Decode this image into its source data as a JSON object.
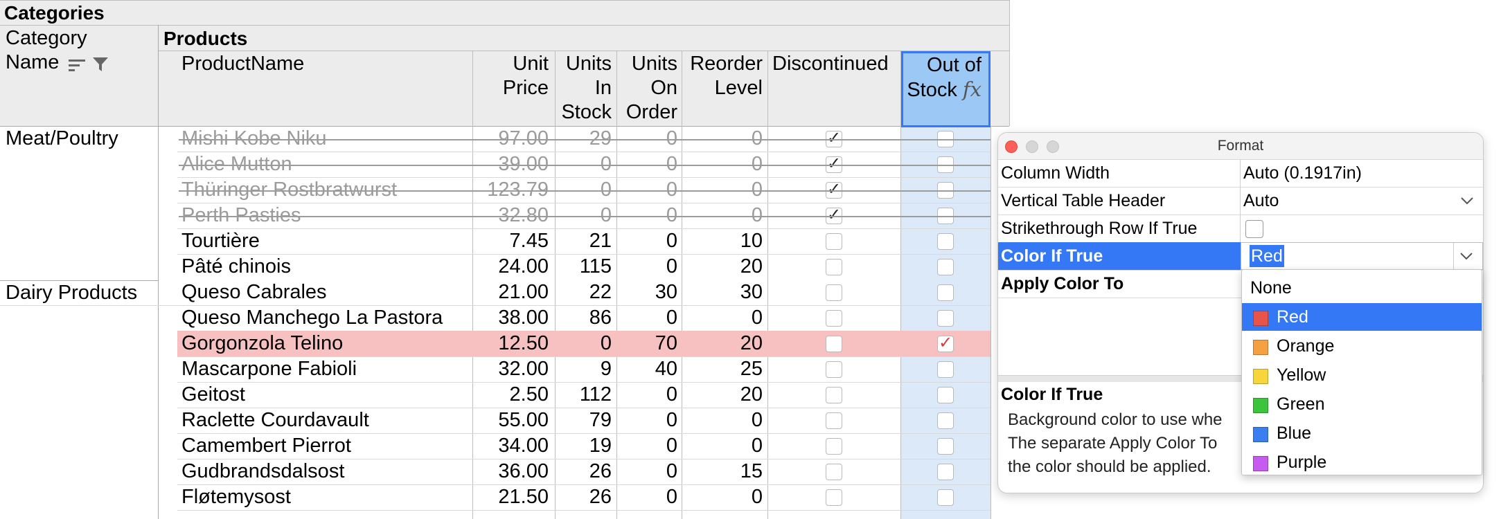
{
  "table": {
    "group_header": "Categories",
    "category_header_line1": "Category",
    "category_header_line2": "Name",
    "products_header": "Products",
    "columns": {
      "name": "ProductName",
      "price": [
        "Unit",
        "Price"
      ],
      "stock": [
        "Units",
        "In",
        "Stock"
      ],
      "order": [
        "Units",
        "On",
        "Order"
      ],
      "reorder": [
        "Reorder",
        "Level"
      ],
      "discontinued": "Discontinued",
      "outofstock": [
        "Out of",
        "Stock"
      ],
      "formula_symbol": "fx"
    },
    "categories": [
      "Meat/Poultry",
      "Dairy Products"
    ],
    "rows": [
      {
        "name": "Mishi Kobe Niku",
        "price": "97.00",
        "stock": "29",
        "order": "0",
        "reorder": "0",
        "disc": true,
        "oos": false,
        "style": "strike"
      },
      {
        "name": "Alice Mutton",
        "price": "39.00",
        "stock": "0",
        "order": "0",
        "reorder": "0",
        "disc": true,
        "oos": false,
        "style": "strike"
      },
      {
        "name": "Thüringer Rostbratwurst",
        "price": "123.79",
        "stock": "0",
        "order": "0",
        "reorder": "0",
        "disc": true,
        "oos": false,
        "style": "strike"
      },
      {
        "name": "Perth Pasties",
        "price": "32.80",
        "stock": "0",
        "order": "0",
        "reorder": "0",
        "disc": true,
        "oos": false,
        "style": "strike"
      },
      {
        "name": "Tourtière",
        "price": "7.45",
        "stock": "21",
        "order": "0",
        "reorder": "10",
        "disc": false,
        "oos": false,
        "style": "normal"
      },
      {
        "name": "Pâté chinois",
        "price": "24.00",
        "stock": "115",
        "order": "0",
        "reorder": "20",
        "disc": false,
        "oos": false,
        "style": "normal"
      },
      {
        "name": "Queso Cabrales",
        "price": "21.00",
        "stock": "22",
        "order": "30",
        "reorder": "30",
        "disc": false,
        "oos": false,
        "style": "normal"
      },
      {
        "name": "Queso Manchego La Pastora",
        "price": "38.00",
        "stock": "86",
        "order": "0",
        "reorder": "0",
        "disc": false,
        "oos": false,
        "style": "normal"
      },
      {
        "name": "Gorgonzola Telino",
        "price": "12.50",
        "stock": "0",
        "order": "70",
        "reorder": "20",
        "disc": false,
        "oos": true,
        "style": "red"
      },
      {
        "name": "Mascarpone Fabioli",
        "price": "32.00",
        "stock": "9",
        "order": "40",
        "reorder": "25",
        "disc": false,
        "oos": false,
        "style": "normal"
      },
      {
        "name": "Geitost",
        "price": "2.50",
        "stock": "112",
        "order": "0",
        "reorder": "20",
        "disc": false,
        "oos": false,
        "style": "normal"
      },
      {
        "name": "Raclette Courdavault",
        "price": "55.00",
        "stock": "79",
        "order": "0",
        "reorder": "0",
        "disc": false,
        "oos": false,
        "style": "normal"
      },
      {
        "name": "Camembert Pierrot",
        "price": "34.00",
        "stock": "19",
        "order": "0",
        "reorder": "0",
        "disc": false,
        "oos": false,
        "style": "normal"
      },
      {
        "name": "Gudbrandsdalsost",
        "price": "36.00",
        "stock": "26",
        "order": "0",
        "reorder": "15",
        "disc": false,
        "oos": false,
        "style": "normal"
      },
      {
        "name": "Fløtemysost",
        "price": "21.50",
        "stock": "26",
        "order": "0",
        "reorder": "0",
        "disc": false,
        "oos": false,
        "style": "normal"
      }
    ]
  },
  "format_panel": {
    "title": "Format",
    "rows": [
      {
        "label": "Column Width",
        "value": "Auto (0.1917in)"
      },
      {
        "label": "Vertical Table Header",
        "value": "Auto"
      },
      {
        "label": "Strikethrough Row If True",
        "value": ""
      },
      {
        "label": "Color If True",
        "value": "Red"
      },
      {
        "label": "Apply Color To",
        "value": ""
      }
    ],
    "help_title": "Color If True",
    "help_lines": [
      "Background color to use whe",
      "The separate Apply Color To",
      "the color should be applied."
    ],
    "dropdown_options": [
      {
        "label": "None",
        "color": ""
      },
      {
        "label": "Red",
        "color": "#e8544b"
      },
      {
        "label": "Orange",
        "color": "#f5a142"
      },
      {
        "label": "Yellow",
        "color": "#f7d63c"
      },
      {
        "label": "Green",
        "color": "#3cc43c"
      },
      {
        "label": "Blue",
        "color": "#3b7ef0"
      },
      {
        "label": "Purple",
        "color": "#c65bf0"
      }
    ],
    "selected_option": "Red"
  },
  "colors": {
    "accent": "#3478f6",
    "highlight_row": "#f7c1c1",
    "selected_column": "#dce9f8",
    "selected_header": "#9cc8f6"
  }
}
